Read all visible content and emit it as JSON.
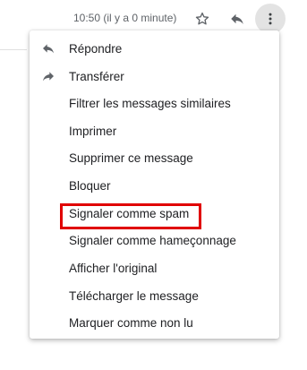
{
  "header": {
    "timestamp": "10:50 (il y a 0 minute)",
    "star_icon": "star-outline-icon",
    "reply_icon": "reply-icon",
    "more_icon": "more-vertical-icon"
  },
  "menu": {
    "items": [
      {
        "label": "Répondre",
        "icon": "reply-icon"
      },
      {
        "label": "Transférer",
        "icon": "forward-icon"
      },
      {
        "label": "Filtrer les messages similaires"
      },
      {
        "label": "Imprimer"
      },
      {
        "label": "Supprimer ce message"
      },
      {
        "label": "Bloquer"
      },
      {
        "label": "Signaler comme spam",
        "highlighted": true
      },
      {
        "label": "Signaler comme hameçonnage"
      },
      {
        "label": "Afficher l'original"
      },
      {
        "label": "Télécharger le message"
      },
      {
        "label": "Marquer comme non lu"
      }
    ]
  },
  "colors": {
    "highlight_border": "#e00000",
    "icon": "#5f6368",
    "text": "#202124"
  }
}
